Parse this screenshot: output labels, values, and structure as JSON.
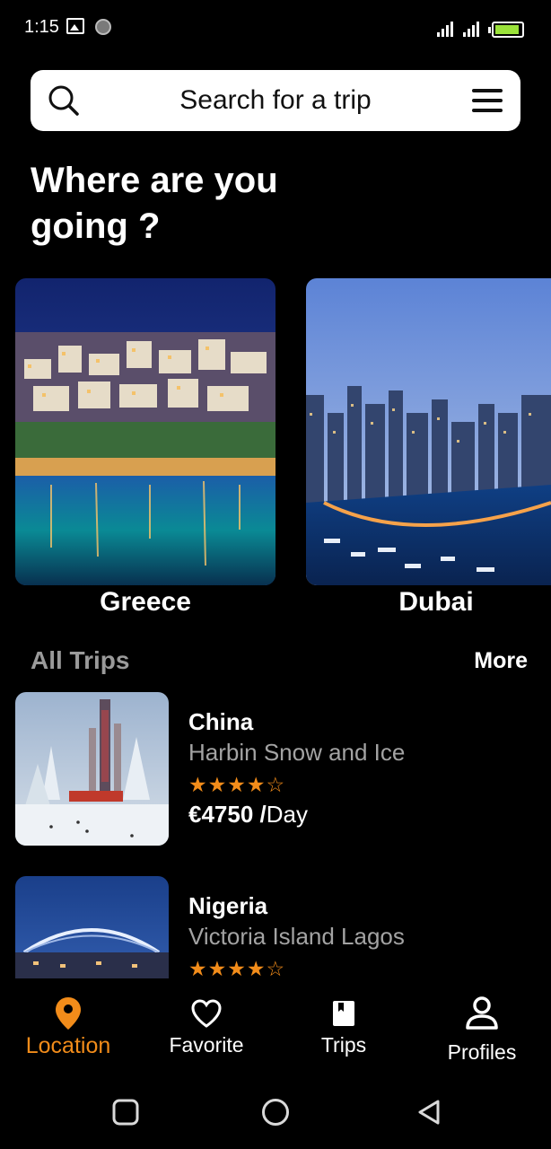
{
  "status_bar": {
    "time": "1:15"
  },
  "search": {
    "placeholder": "Search for a trip"
  },
  "headline": "Where are you going ?",
  "destinations": [
    {
      "name": "Greece"
    },
    {
      "name": "Dubai"
    }
  ],
  "all_trips": {
    "title": "All Trips",
    "more_label": "More",
    "items": [
      {
        "country": "China",
        "place": "Harbin Snow and Ice",
        "rating": 4,
        "max_rating": 5,
        "price_amount": "€4750 /",
        "price_unit": "Day"
      },
      {
        "country": "Nigeria",
        "place": "Victoria Island Lagos",
        "rating": 4,
        "max_rating": 5
      }
    ]
  },
  "bottom_nav": {
    "items": [
      {
        "label": "Location",
        "icon": "location-pin-icon",
        "active": true
      },
      {
        "label": "Favorite",
        "icon": "heart-icon",
        "active": false
      },
      {
        "label": "Trips",
        "icon": "book-icon",
        "active": false
      },
      {
        "label": "Profiles",
        "icon": "user-icon",
        "active": false
      }
    ]
  },
  "colors": {
    "accent": "#f28c1a",
    "background": "#000000",
    "muted_text": "#a3a3a3"
  }
}
